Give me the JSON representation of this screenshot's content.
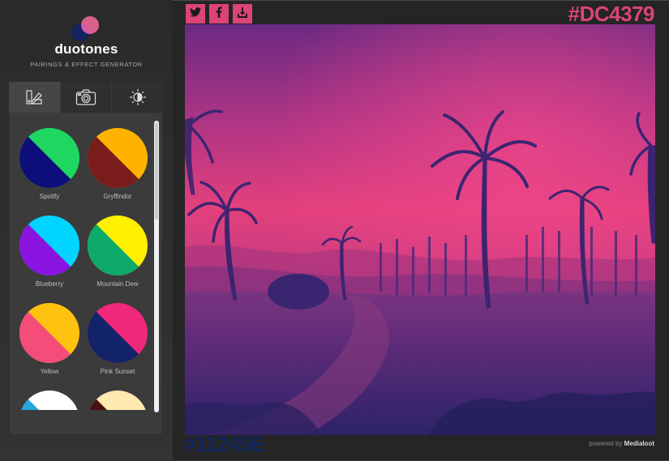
{
  "brand": {
    "name": "duotones",
    "tagline": "PAIRINGS & EFFECT GENERATOR"
  },
  "tabs": [
    {
      "icon": "palette-swatches-icon",
      "active": true
    },
    {
      "icon": "camera-icon",
      "active": false
    },
    {
      "icon": "brightness-icon",
      "active": false
    }
  ],
  "swatches": [
    {
      "label": "Spotify",
      "color_a": "#1ED760",
      "color_b": "#0E0E7A"
    },
    {
      "label": "Gryffindor",
      "color_a": "#FFB300",
      "color_b": "#7A1C1C"
    },
    {
      "label": "Blueberry",
      "color_a": "#00D4FF",
      "color_b": "#8B14E0"
    },
    {
      "label": "Mountain Dew",
      "color_a": "#FFF000",
      "color_b": "#0DAA6A"
    },
    {
      "label": "Yellow",
      "color_a": "#FFC20E",
      "color_b": "#F44D7A"
    },
    {
      "label": "Pink Sunset",
      "color_a": "#F0287A",
      "color_b": "#12236A"
    },
    {
      "label": "",
      "color_a": "#FFFFFF",
      "color_b": "#29A3E0"
    },
    {
      "label": "",
      "color_a": "#FFE9B0",
      "color_b": "#4A1010"
    }
  ],
  "share": {
    "twitter": "twitter-icon",
    "facebook": "facebook-icon",
    "download": "download-icon"
  },
  "colors": {
    "highlight": "#DC4379",
    "shadow": "#11245E"
  },
  "highlight_hex": "#DC4379",
  "shadow_hex": "#11245E",
  "footer": {
    "powered_prefix": "powered by",
    "powered_brand": "Medialoot"
  }
}
